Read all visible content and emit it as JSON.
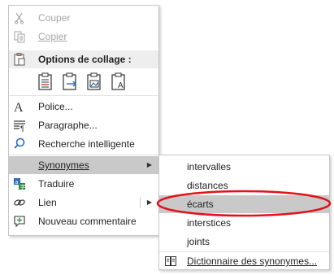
{
  "context_menu": {
    "items": {
      "cut": {
        "label": "Couper",
        "icon": "scissors-icon",
        "disabled": true
      },
      "copy": {
        "label": "Copier",
        "icon": "copy-icon",
        "disabled": true
      },
      "paste_options": {
        "label": "Options de collage :",
        "icon": "clipboard-icon"
      },
      "font": {
        "label": "Police...",
        "icon": "font-icon"
      },
      "paragraph": {
        "label": "Paragraphe...",
        "icon": "paragraph-icon"
      },
      "smart_lookup": {
        "label": "Recherche intelligente",
        "icon": "search-icon"
      },
      "synonyms": {
        "label": "Synonymes",
        "icon": "none",
        "has_submenu": true
      },
      "translate": {
        "label": "Traduire",
        "icon": "translate-icon"
      },
      "link": {
        "label": "Lien",
        "icon": "link-icon",
        "has_submenu": true
      },
      "new_comment": {
        "label": "Nouveau commentaire",
        "icon": "comment-icon"
      }
    },
    "paste_icons": [
      "paste-keep-formatting-icon",
      "paste-merge-formatting-icon",
      "paste-picture-icon",
      "paste-text-only-icon"
    ]
  },
  "synonyms_submenu": {
    "items": [
      {
        "label": "intervalles"
      },
      {
        "label": "distances"
      },
      {
        "label": "écarts",
        "highlighted": true
      },
      {
        "label": "interstices"
      },
      {
        "label": "joints"
      }
    ],
    "thesaurus": {
      "label": "Dictionnaire des synonymes...",
      "icon": "thesaurus-icon"
    }
  },
  "colors": {
    "highlight": "#c9c9c9",
    "annotation": "#e2111b",
    "icon_blue": "#2b6cb5",
    "icon_green": "#2a8a3e"
  }
}
